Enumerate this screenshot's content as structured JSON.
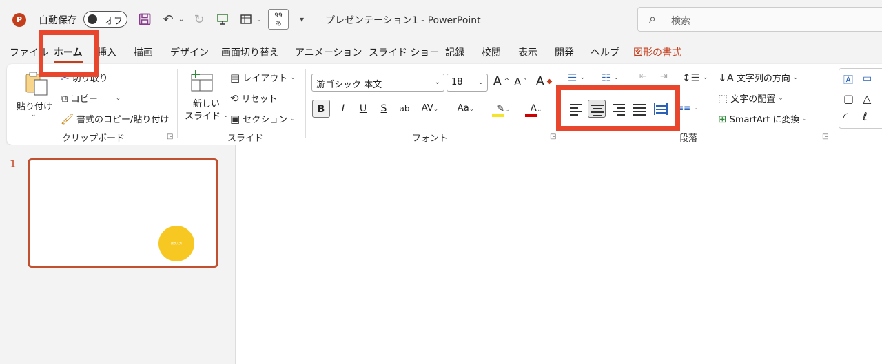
{
  "titlebar": {
    "app_logo": "P",
    "autosave_label": "自動保存",
    "autosave_state": "オフ",
    "quick_badge_line1": "99",
    "quick_badge_line2": "あ",
    "doc_title": "プレゼンテーション1  -  PowerPoint",
    "search_placeholder": "検索"
  },
  "tabs": [
    "ファイル",
    "ホーム",
    "挿入",
    "描画",
    "デザイン",
    "画面切り替え",
    "アニメーション",
    "スライド ショー",
    "記録",
    "校閲",
    "表示",
    "開発",
    "ヘルプ",
    "図形の書式"
  ],
  "ribbon": {
    "clipboard": {
      "paste": "貼り付け",
      "cut": "切り取り",
      "copy": "コピー",
      "format_painter": "書式のコピー/貼り付け",
      "label": "クリップボード"
    },
    "slides": {
      "new_slide_line1": "新しい",
      "new_slide_line2": "スライド",
      "layout": "レイアウト",
      "reset": "リセット",
      "section": "セクション",
      "label": "スライド"
    },
    "font": {
      "font_name": "游ゴシック 本文",
      "font_size": "18",
      "label": "フォント"
    },
    "paragraph": {
      "text_direction": "文字列の方向",
      "align_text": "文字の配置",
      "smartart": "SmartArt に変換",
      "label": "段落"
    }
  },
  "thumbnails": [
    {
      "number": "1",
      "circle_text": "数字入力"
    }
  ],
  "colors": {
    "accent": "#c43e1c",
    "highlight": "#e8472d",
    "circle": "#f6c821"
  }
}
